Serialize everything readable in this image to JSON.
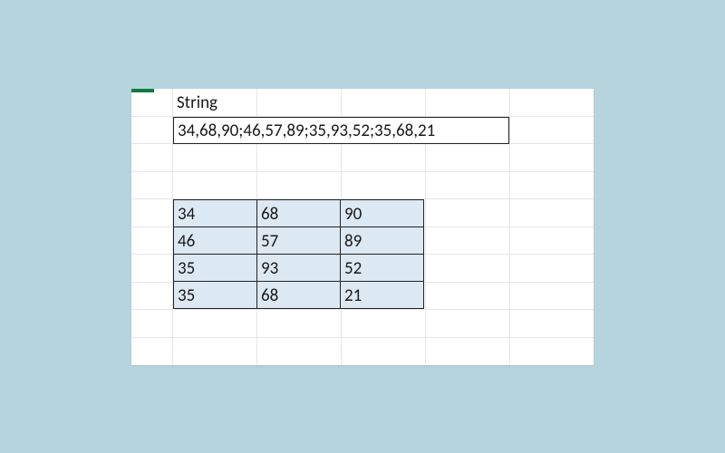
{
  "header_label": "String",
  "string_value": "34,68,90;46,57,89;35,93,52;35,68,21",
  "matrix": [
    [
      "34",
      "68",
      "90"
    ],
    [
      "46",
      "57",
      "89"
    ],
    [
      "35",
      "93",
      "52"
    ],
    [
      "35",
      "68",
      "21"
    ]
  ]
}
